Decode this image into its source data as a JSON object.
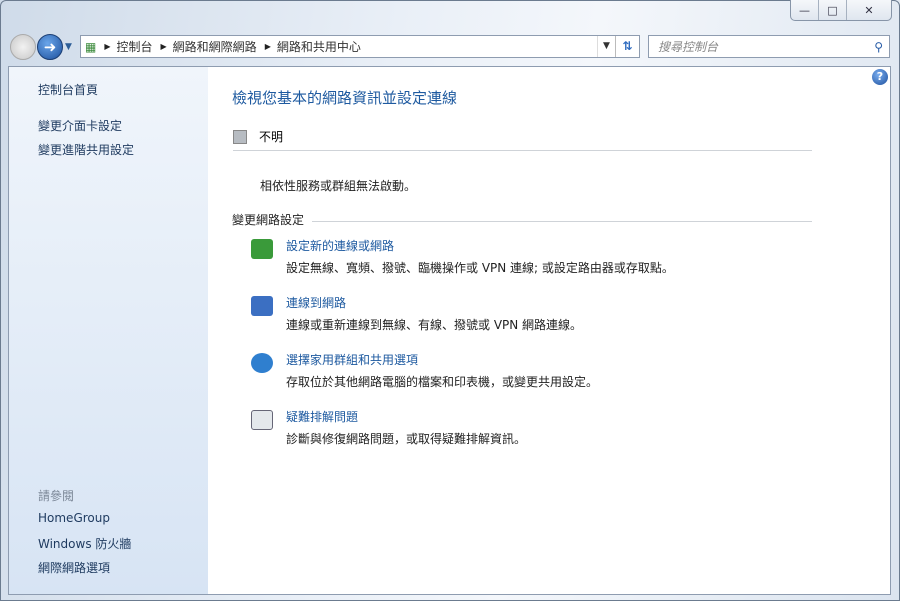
{
  "window": {
    "minimize": "—",
    "maximize": "□",
    "close": "✕"
  },
  "address": {
    "segments": [
      "控制台",
      "網路和網際網路",
      "網路和共用中心"
    ]
  },
  "search": {
    "placeholder": "搜尋控制台"
  },
  "sidebar": {
    "home": "控制台首頁",
    "links": [
      "變更介面卡設定",
      "變更進階共用設定"
    ],
    "see_also": "請參閱",
    "see_links": [
      "HomeGroup",
      "Windows 防火牆",
      "網際網路選項"
    ]
  },
  "main": {
    "title": "檢視您基本的網路資訊並設定連線",
    "network_status": "不明",
    "message": "相依性服務或群組無法啟動。",
    "section": "變更網路設定",
    "tasks": [
      {
        "title": "設定新的連線或網路",
        "desc": "設定無線、寬頻、撥號、臨機操作或 VPN 連線; 或設定路由器或存取點。",
        "color": "#3a9a3a"
      },
      {
        "title": "連線到網路",
        "desc": "連線或重新連線到無線、有線、撥號或 VPN 網路連線。",
        "color": "#3b6fc2"
      },
      {
        "title": "選擇家用群組和共用選項",
        "desc": "存取位於其他網路電腦的檔案和印表機，或變更共用設定。",
        "color": "#2f7fcf"
      },
      {
        "title": "疑難排解問題",
        "desc": "診斷與修復網路問題，或取得疑難排解資訊。",
        "color": "#5f8f5f"
      }
    ]
  }
}
